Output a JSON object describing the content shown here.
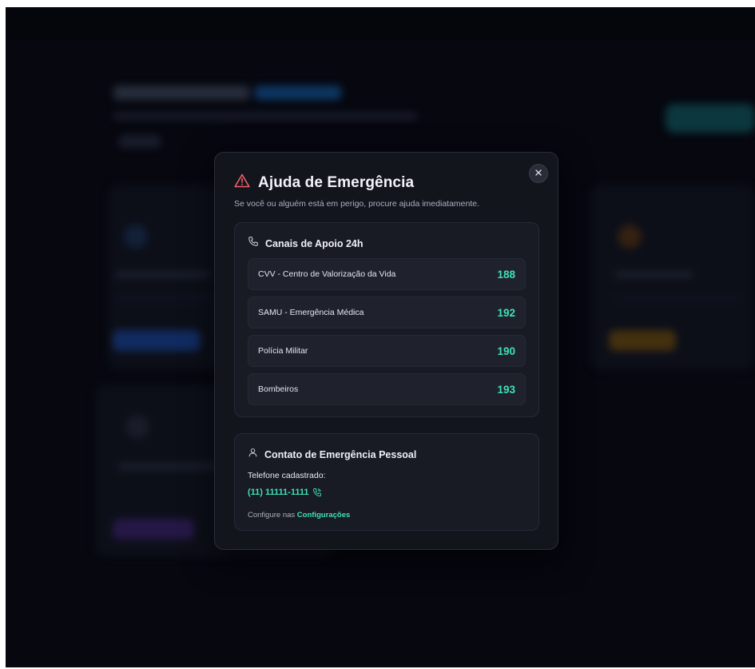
{
  "modal": {
    "title": "Ajuda de Emergência",
    "subtitle": "Se você ou alguém está em perigo, procure ajuda imediatamente."
  },
  "support": {
    "title": "Canais de Apoio 24h",
    "lines": [
      {
        "name": "CVV - Centro de Valorização da Vida",
        "number": "188"
      },
      {
        "name": "SAMU - Emergência Médica",
        "number": "192"
      },
      {
        "name": "Polícia Militar",
        "number": "190"
      },
      {
        "name": "Bombeiros",
        "number": "193"
      }
    ]
  },
  "personal": {
    "title": "Contato de Emergência Pessoal",
    "phone_label": "Telefone cadastrado:",
    "phone": "(11) 11111-1111",
    "config_prefix": "Configure nas",
    "config_link": "Configurações"
  },
  "colors": {
    "accent": "#3fe0b9",
    "danger": "#f0606a",
    "background": "#06070f",
    "modal": "#13151d"
  },
  "icons": {
    "title": "warning-triangle-icon",
    "support": "phone-icon",
    "personal": "user-icon",
    "phone_call": "phone-call-icon",
    "close": "close-icon"
  }
}
